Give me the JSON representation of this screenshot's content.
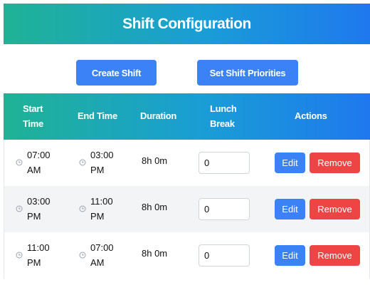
{
  "header": {
    "title": "Shift Configuration"
  },
  "toolbar": {
    "create_label": "Create Shift",
    "priorities_label": "Set Shift Priorities"
  },
  "table": {
    "columns": [
      "Start Time",
      "End Time",
      "Duration",
      "Lunch Break",
      "Actions"
    ],
    "rows": [
      {
        "start": "07:00 AM",
        "end": "03:00 PM",
        "duration": "8h 0m",
        "lunch": "0",
        "edit": "Edit",
        "remove": "Remove"
      },
      {
        "start": "03:00 PM",
        "end": "11:00 PM",
        "duration": "8h 0m",
        "lunch": "0",
        "edit": "Edit",
        "remove": "Remove"
      },
      {
        "start": "11:00 PM",
        "end": "07:00 AM",
        "duration": "8h 0m",
        "lunch": "0",
        "edit": "Edit",
        "remove": "Remove"
      }
    ]
  },
  "colors": {
    "gradient_start": "#1fb394",
    "gradient_end": "#1f78ee",
    "primary": "#3b82f6",
    "danger": "#ef4444",
    "stripe": "#f3f4f6"
  },
  "icons": {
    "time": "clock-icon"
  }
}
